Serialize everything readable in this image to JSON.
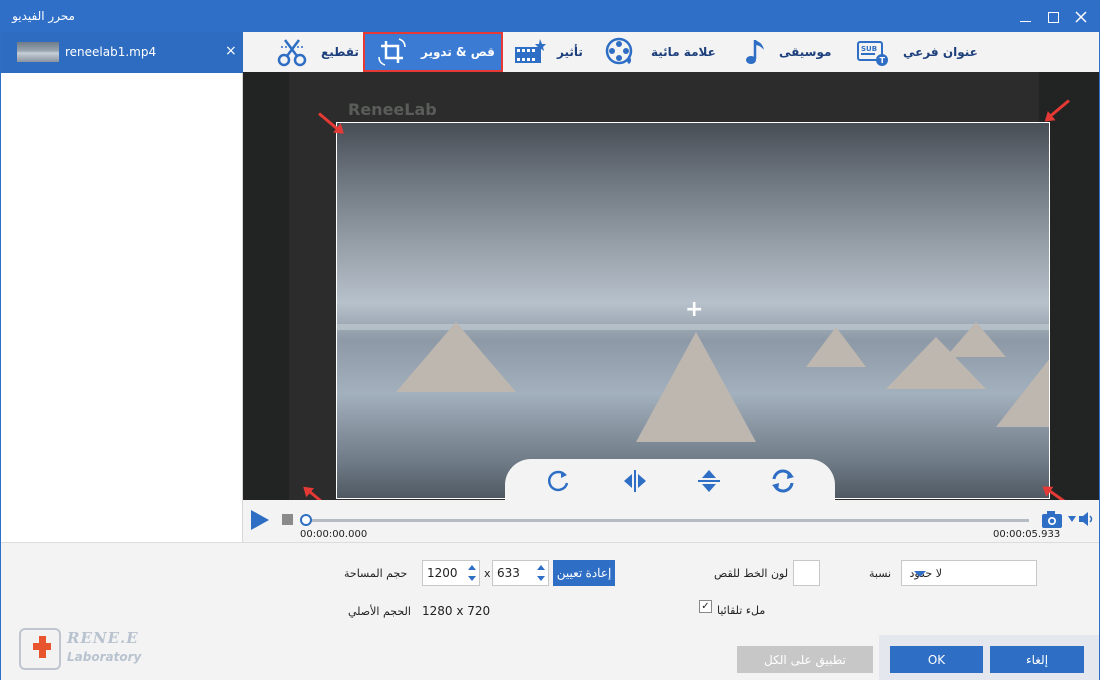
{
  "window": {
    "title": "محرر الفيديو"
  },
  "files": [
    {
      "name": "reneelab1.mp4",
      "close": "×"
    }
  ],
  "toolbar": {
    "items": [
      {
        "label": "عنوان فرعي",
        "icon": "subtitle-icon"
      },
      {
        "label": "موسيقى",
        "icon": "music-note-icon"
      },
      {
        "label": "علامة مائية",
        "icon": "watermark-film-reel-icon"
      },
      {
        "label": "تأثير",
        "icon": "effect-clapper-icon"
      },
      {
        "label": "قص & تدوير",
        "icon": "crop-rotate-icon",
        "active": true
      },
      {
        "label": "تقطيع",
        "icon": "scissors-cut-icon"
      }
    ]
  },
  "preview": {
    "watermark": "ReneeLab",
    "center_marker": "+",
    "chevron": "⌄"
  },
  "timeline": {
    "current": "00:00:00.000",
    "duration": "00:00:05.933"
  },
  "settings": {
    "area_label": "حجم المساحة",
    "width": "1200",
    "height": "633",
    "x_sep": "x",
    "reset_label": "إعادة تعيين",
    "line_color_label": "لون الخط للقص",
    "ratio_label": "نسبة",
    "ratio_value": "لا حدود",
    "original_label": "الحجم الأصلي",
    "original_value": "1280 x 720",
    "autofill_label": "ملء تلقائيا",
    "autofill_checked": true
  },
  "buttons": {
    "apply_all": "تطبيق على الكل",
    "ok": "OK",
    "cancel": "إلغاء"
  },
  "brand": {
    "line1": "RENE.E",
    "line2": "Laboratory"
  },
  "colors": {
    "accent": "#2e6ec4",
    "highlight_border": "#e53935",
    "arrow": "#e53935"
  }
}
